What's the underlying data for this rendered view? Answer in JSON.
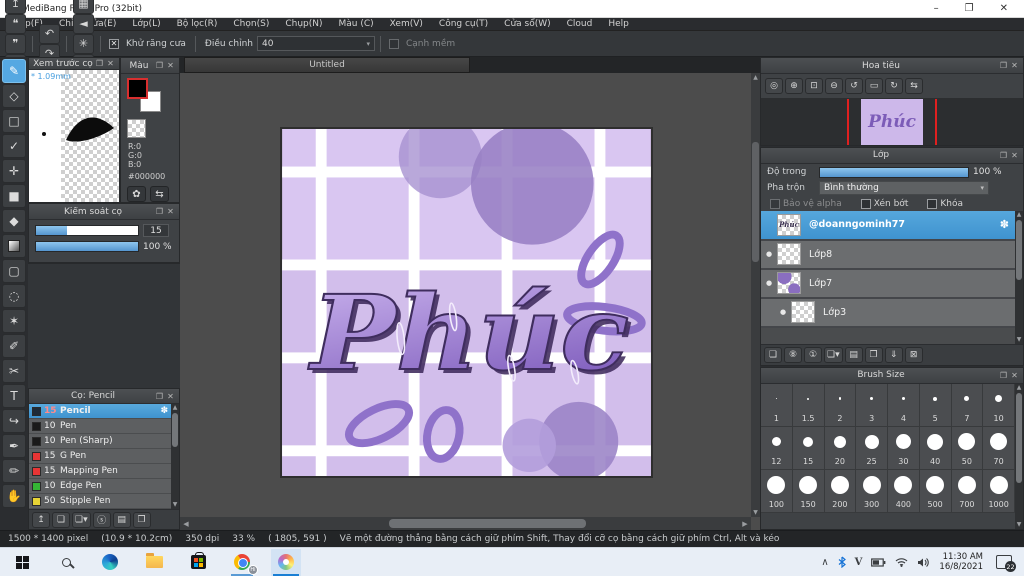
{
  "window": {
    "title": "MediBang Paint Pro (32bit)",
    "controls": {
      "minimize": "–",
      "restore": "❐",
      "close": "✕"
    }
  },
  "menu": {
    "items": [
      "Tệp(F)",
      "Chỉnh sửa(E)",
      "Lớp(L)",
      "Bộ lọc(R)",
      "Chọn(S)",
      "Chụp(N)",
      "Màu (C)",
      "Xem(V)",
      "Công cụ(T)",
      "Cửa sổ(W)",
      "Cloud",
      "Help"
    ]
  },
  "icon_glyphs": {
    "popout": "❐",
    "close": "✕",
    "check": "✕",
    "gear": "✽",
    "dot": "●",
    "palette": "✿",
    "swap": "⇆",
    "caret": "▾",
    "up_arrow": "▲",
    "down_arrow": "▼",
    "left_arrow": "◀",
    "right_arrow": "▶"
  },
  "toolbar": {
    "file_icons": [
      {
        "name": "cloud-save-icon",
        "glyph": "☁"
      },
      {
        "name": "share-icon",
        "glyph": "↥"
      },
      {
        "name": "comment-icon",
        "glyph": "❝"
      },
      {
        "name": "comment-list-icon",
        "glyph": "❞"
      },
      {
        "name": "document-icon",
        "glyph": "❒"
      },
      {
        "name": "detail-settings-icon",
        "glyph": "⊞"
      },
      {
        "name": "grid-settings-icon",
        "glyph": "▦"
      }
    ],
    "history_icons": [
      {
        "name": "undo-icon",
        "glyph": "↶"
      },
      {
        "name": "redo-icon",
        "glyph": "↷"
      }
    ],
    "snap_icons": [
      {
        "name": "snap-off-icon",
        "glyph": "⊘",
        "active": true
      },
      {
        "name": "snap-parallel-icon",
        "glyph": "≋"
      },
      {
        "name": "snap-grid-icon",
        "glyph": "▦"
      },
      {
        "name": "snap-vanishing-icon",
        "glyph": "◄"
      },
      {
        "name": "snap-radial-icon",
        "glyph": "✳"
      },
      {
        "name": "snap-concentric-icon",
        "glyph": "◎"
      },
      {
        "name": "snap-curve-icon",
        "glyph": "∿"
      },
      {
        "name": "snap-ellipse-icon",
        "glyph": "◯"
      },
      {
        "name": "snap-settings-icon",
        "glyph": "⚙"
      }
    ],
    "antialias": {
      "label": "Khử răng cưa",
      "checked": true
    },
    "correction": {
      "label": "Điều chỉnh",
      "value": "40"
    },
    "soft_edge": {
      "label": "Cạnh mềm",
      "checked": false
    }
  },
  "tools": {
    "items": [
      {
        "name": "brush-tool",
        "glyph": "✎",
        "selected": true
      },
      {
        "name": "eraser-tool",
        "glyph": "◇"
      },
      {
        "name": "shape-brush-tool",
        "glyph": "□"
      },
      {
        "name": "correction-pen-tool",
        "glyph": "✓"
      },
      {
        "name": "move-tool",
        "glyph": "✛"
      },
      {
        "name": "fill-rect-tool",
        "glyph": "■"
      },
      {
        "name": "bucket-tool",
        "glyph": "◆"
      },
      {
        "name": "gradient-tool",
        "glyph": "",
        "gradient": true
      },
      {
        "name": "marquee-select-tool",
        "glyph": "▢"
      },
      {
        "name": "lasso-tool",
        "glyph": "◌"
      },
      {
        "name": "magic-wand-tool",
        "glyph": "✶"
      },
      {
        "name": "select-pen-tool",
        "glyph": "✐"
      },
      {
        "name": "select-eraser-tool",
        "glyph": "✂"
      },
      {
        "name": "text-tool",
        "glyph": "T"
      },
      {
        "name": "operation-tool",
        "glyph": "↪"
      },
      {
        "name": "div-pen-tool",
        "glyph": "✒"
      },
      {
        "name": "snap-pen-tool",
        "glyph": "✏"
      },
      {
        "name": "hand-tool",
        "glyph": "✋"
      }
    ]
  },
  "panels": {
    "brush_preview": {
      "title": "Xem trước cọ",
      "size_label": "* 1.09mm"
    },
    "color": {
      "title": "Màu",
      "r": "R:0",
      "g": "G:0",
      "b": "B:0",
      "hex": "#000000"
    },
    "brush_control": {
      "title": "Kiểm soát cọ",
      "size_value": "15",
      "size_fill": 30,
      "opacity_value": "100 %",
      "opacity_fill": 100
    },
    "brush_list": {
      "title": "Cọ: Pencil",
      "brushes": [
        {
          "size": "15",
          "name": "Pencil",
          "swatch": "#1e2b38",
          "selected": true
        },
        {
          "size": "10",
          "name": "Pen",
          "swatch": "#1a1a1a"
        },
        {
          "size": "10",
          "name": "Pen (Sharp)",
          "swatch": "#1a1a1a"
        },
        {
          "size": "15",
          "name": "G Pen",
          "swatch": "#e83535"
        },
        {
          "size": "15",
          "name": "Mapping Pen",
          "swatch": "#e83535"
        },
        {
          "size": "10",
          "name": "Edge Pen",
          "swatch": "#35b535"
        },
        {
          "size": "50",
          "name": "Stipple Pen",
          "swatch": "#e8d435"
        }
      ],
      "footer_icons": [
        {
          "name": "upload-brush-icon",
          "glyph": "↥"
        },
        {
          "name": "add-brush-icon",
          "glyph": "❏"
        },
        {
          "name": "add-brush-menu-icon",
          "glyph": "❏▾"
        },
        {
          "name": "script-brush-icon",
          "glyph": "ⓢ"
        },
        {
          "name": "brush-folder-icon",
          "glyph": "▤"
        },
        {
          "name": "duplicate-brush-icon",
          "glyph": "❐"
        }
      ]
    },
    "navigator": {
      "title": "Hoa tiêu",
      "icons": [
        {
          "name": "zoom-100-icon",
          "glyph": "◎"
        },
        {
          "name": "zoom-in-icon",
          "glyph": "⊕"
        },
        {
          "name": "fit-window-icon",
          "glyph": "⊡"
        },
        {
          "name": "zoom-out-icon",
          "glyph": "⊖"
        },
        {
          "name": "rotate-left-icon",
          "glyph": "↺"
        },
        {
          "name": "reset-rotation-icon",
          "glyph": "▭"
        },
        {
          "name": "rotate-right-icon",
          "glyph": "↻"
        },
        {
          "name": "flip-view-icon",
          "glyph": "⇆"
        }
      ]
    },
    "layer": {
      "title": "Lớp",
      "opacity_label": "Độ trong",
      "opacity_value": "100 %",
      "opacity_fill": 100,
      "blend_label": "Pha trộn",
      "blend_value": "Bình thường",
      "protect_alpha": "Bảo vệ alpha",
      "clipping": "Xén bớt",
      "lock": "Khóa",
      "layers": [
        {
          "name": "@doanngominh77",
          "selected": true,
          "thumb": "text"
        },
        {
          "name": "Lớp8",
          "thumb": "checker"
        },
        {
          "name": "Lớp7",
          "thumb": "blobs"
        },
        {
          "name": "Lớp3",
          "thumb": "checker",
          "indent": true
        }
      ],
      "footer_icons": [
        {
          "name": "add-layer-icon",
          "glyph": "❏"
        },
        {
          "name": "add-8bit-layer-icon",
          "glyph": "⑧"
        },
        {
          "name": "add-1bit-layer-icon",
          "glyph": "①"
        },
        {
          "name": "add-layer-menu-icon",
          "glyph": "❏▾"
        },
        {
          "name": "layer-folder-icon",
          "glyph": "▤"
        },
        {
          "name": "duplicate-layer-icon",
          "glyph": "❐"
        },
        {
          "name": "merge-layer-icon",
          "glyph": "⇓"
        },
        {
          "name": "delete-layer-icon",
          "glyph": "⊠"
        }
      ]
    },
    "brush_size": {
      "title": "Brush Size",
      "sizes": [
        "1",
        "1.5",
        "2",
        "3",
        "4",
        "5",
        "7",
        "10",
        "12",
        "15",
        "20",
        "25",
        "30",
        "40",
        "50",
        "70",
        "100",
        "150",
        "200",
        "300",
        "400",
        "500",
        "700",
        "1000"
      ]
    }
  },
  "canvas": {
    "tab": "Untitled",
    "lettering": "Phúc"
  },
  "status": {
    "size": "1500 * 1400 pixel",
    "physical": "(10.9 * 10.2cm)",
    "dpi": "350 dpi",
    "zoom": "33 %",
    "coords": "( 1805, 591 )",
    "hint": "Vẽ một đường thẳng bằng cách giữ phím Shift, Thay đổi cỡ cọ bằng cách giữ phím Ctrl, Alt và kéo"
  },
  "taskbar": {
    "time": "11:30 AM",
    "date": "16/8/2021",
    "badge": "22",
    "chrome_badge": "Hi"
  },
  "colors": {
    "accent": "#55a8e2",
    "selection": "#4a9fd6",
    "slider_blue": "#6db6e8",
    "canvas_lavender": "#d6c2ee",
    "artwork_purple": "#8a68c0",
    "red_guide": "#e02020"
  }
}
